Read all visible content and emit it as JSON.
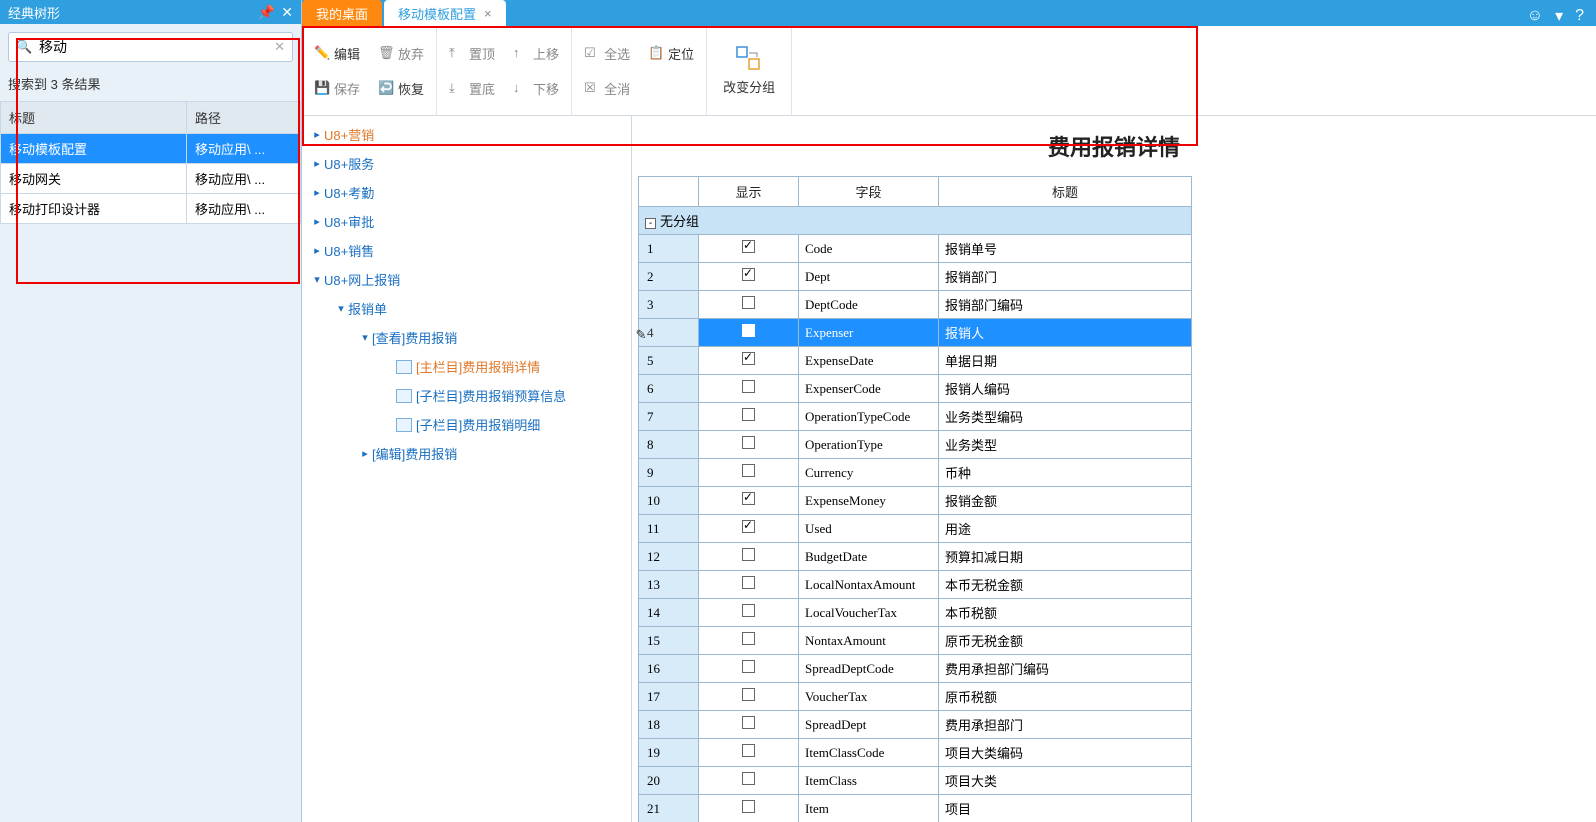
{
  "sidebar": {
    "title": "经典树形",
    "search_value": "移动",
    "result_text": "搜索到 3 条结果",
    "columns": {
      "title": "标题",
      "path": "路径"
    },
    "results": [
      {
        "title": "移动模板配置",
        "path": "移动应用\\ ...",
        "selected": true
      },
      {
        "title": "移动网关",
        "path": "移动应用\\ ...",
        "selected": false
      },
      {
        "title": "移动打印设计器",
        "path": "移动应用\\ ...",
        "selected": false
      }
    ]
  },
  "tabs": [
    {
      "label": "我的桌面",
      "style": "orange"
    },
    {
      "label": "移动模板配置",
      "style": "white",
      "closable": true
    }
  ],
  "toolbar": {
    "edit": "编辑",
    "discard": "放弃",
    "save": "保存",
    "restore": "恢复",
    "top": "置顶",
    "up": "上移",
    "bottom": "置底",
    "down": "下移",
    "select_all": "全选",
    "locate": "定位",
    "deselect": "全消",
    "change_group": "改变分组"
  },
  "tree": [
    {
      "label": "U8+营销",
      "indent": 0,
      "caret": "›",
      "style": "orange"
    },
    {
      "label": "U8+服务",
      "indent": 0,
      "caret": "›"
    },
    {
      "label": "U8+考勤",
      "indent": 0,
      "caret": "›"
    },
    {
      "label": "U8+审批",
      "indent": 0,
      "caret": "›"
    },
    {
      "label": "U8+销售",
      "indent": 0,
      "caret": "›"
    },
    {
      "label": "U8+网上报销",
      "indent": 0,
      "caret": "⌄"
    },
    {
      "label": "报销单",
      "indent": 1,
      "caret": "⌄"
    },
    {
      "label": "[查看]费用报销",
      "indent": 2,
      "caret": "⌄"
    },
    {
      "label": "[主栏目]费用报销详情",
      "indent": 3,
      "icon": true,
      "style": "orange"
    },
    {
      "label": "[子栏目]费用报销预算信息",
      "indent": 3,
      "icon": true
    },
    {
      "label": "[子栏目]费用报销明细",
      "indent": 3,
      "icon": true
    },
    {
      "label": "[编辑]费用报销",
      "indent": 2,
      "caret": "›"
    }
  ],
  "panel_title": "费用报销详情",
  "grid": {
    "headers": {
      "show": "显示",
      "field": "字段",
      "title": "标题"
    },
    "group_label": "无分组",
    "rows": [
      {
        "n": 1,
        "chk": true,
        "field": "Code",
        "title": "报销单号"
      },
      {
        "n": 2,
        "chk": true,
        "field": "Dept",
        "title": "报销部门"
      },
      {
        "n": 3,
        "chk": false,
        "field": "DeptCode",
        "title": "报销部门编码"
      },
      {
        "n": 4,
        "chk": true,
        "field": "Expenser",
        "title": "报销人",
        "selected": true,
        "editing": true
      },
      {
        "n": 5,
        "chk": true,
        "field": "ExpenseDate",
        "title": "单据日期"
      },
      {
        "n": 6,
        "chk": false,
        "field": "ExpenserCode",
        "title": "报销人编码"
      },
      {
        "n": 7,
        "chk": false,
        "field": "OperationTypeCode",
        "title": "业务类型编码"
      },
      {
        "n": 8,
        "chk": false,
        "field": "OperationType",
        "title": "业务类型"
      },
      {
        "n": 9,
        "chk": false,
        "field": "Currency",
        "title": "币种"
      },
      {
        "n": 10,
        "chk": true,
        "field": "ExpenseMoney",
        "title": "报销金额"
      },
      {
        "n": 11,
        "chk": true,
        "field": "Used",
        "title": "用途"
      },
      {
        "n": 12,
        "chk": false,
        "field": "BudgetDate",
        "title": "预算扣减日期"
      },
      {
        "n": 13,
        "chk": false,
        "field": "LocalNontaxAmount",
        "title": "本币无税金额"
      },
      {
        "n": 14,
        "chk": false,
        "field": "LocalVoucherTax",
        "title": "本币税额"
      },
      {
        "n": 15,
        "chk": false,
        "field": "NontaxAmount",
        "title": "原币无税金额"
      },
      {
        "n": 16,
        "chk": false,
        "field": "SpreadDeptCode",
        "title": "费用承担部门编码"
      },
      {
        "n": 17,
        "chk": false,
        "field": "VoucherTax",
        "title": "原币税额"
      },
      {
        "n": 18,
        "chk": false,
        "field": "SpreadDept",
        "title": "费用承担部门"
      },
      {
        "n": 19,
        "chk": false,
        "field": "ItemClassCode",
        "title": "项目大类编码"
      },
      {
        "n": 20,
        "chk": false,
        "field": "ItemClass",
        "title": "项目大类"
      },
      {
        "n": 21,
        "chk": false,
        "field": "Item",
        "title": "项目"
      }
    ]
  }
}
